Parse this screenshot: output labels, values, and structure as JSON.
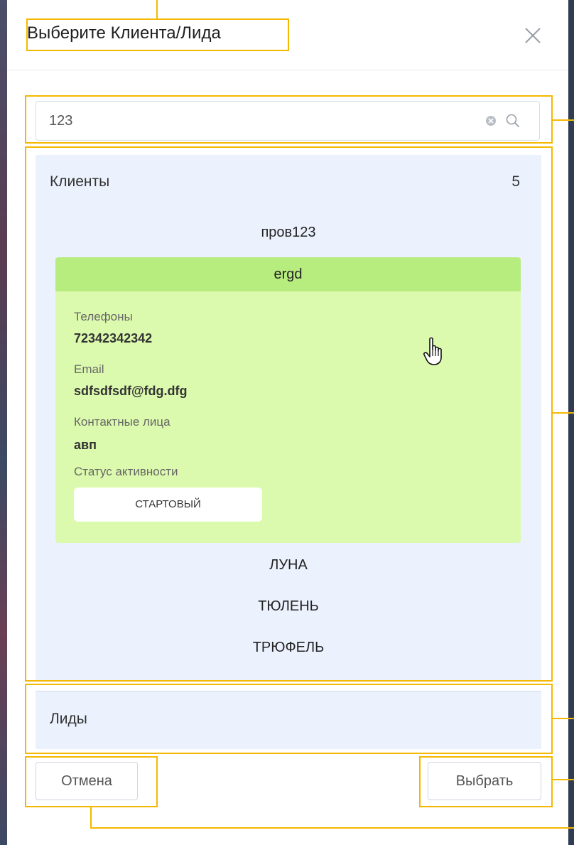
{
  "dialog": {
    "title": "Выберите Клиента/Лида",
    "close_icon": "close-icon"
  },
  "search": {
    "value": "123",
    "clear_icon": "clear-circle-icon",
    "search_icon": "search-icon"
  },
  "clients": {
    "title": "Клиенты",
    "count": "5",
    "items": [
      "пров123",
      "ЛУНА",
      "ТЮЛЕНЬ",
      "ТРЮФЕЛЬ"
    ],
    "expanded": {
      "name": "ergd",
      "phones_label": "Телефоны",
      "phones_value": "72342342342",
      "email_label": "Email",
      "email_value": "sdfsdfsdf@fdg.dfg",
      "contacts_label": "Контактные лица",
      "contacts_value": "авп",
      "status_label": "Статус активности",
      "status_value": "СТАРТОВЫЙ"
    }
  },
  "leads": {
    "title": "Лиды"
  },
  "footer": {
    "cancel_label": "Отмена",
    "select_label": "Выбрать"
  },
  "colors": {
    "panel_bg": "#ecf2fd",
    "card_bg": "#dcfaae",
    "card_header_bg": "#b7ec7e",
    "annotation": "#f5b800"
  }
}
